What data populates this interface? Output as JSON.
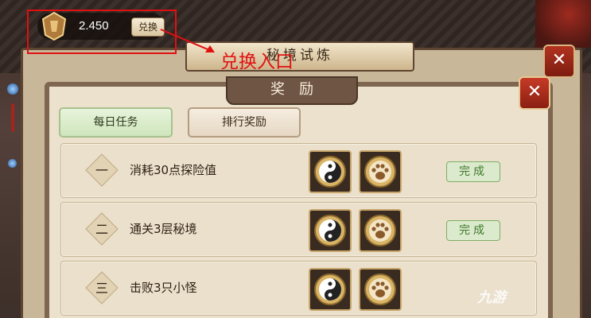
{
  "currency": {
    "amount": "2.450",
    "exchange_label": "兑换",
    "icon": "medal-coin-icon"
  },
  "annotation": {
    "text": "兑换入口",
    "color": "#e01212"
  },
  "back_window": {
    "title": "秘境试炼"
  },
  "reward_panel": {
    "title": "奖励",
    "tabs": [
      {
        "label": "每日任务",
        "active": true
      },
      {
        "label": "排行奖励",
        "active": false
      }
    ],
    "tasks": [
      {
        "index": "一",
        "title": "消耗30点探险值",
        "rewards": [
          "yin-yang-icon",
          "paw-icon"
        ],
        "status": "完成"
      },
      {
        "index": "二",
        "title": "通关3层秘境",
        "rewards": [
          "yin-yang-icon",
          "paw-icon"
        ],
        "status": "完成"
      },
      {
        "index": "三",
        "title": "击败3只小怪",
        "rewards": [
          "yin-yang-icon",
          "paw-icon"
        ],
        "status": ""
      }
    ]
  },
  "watermark": "九游",
  "colors": {
    "done_green": "#3f7a2c",
    "close_red": "#b2331f"
  }
}
